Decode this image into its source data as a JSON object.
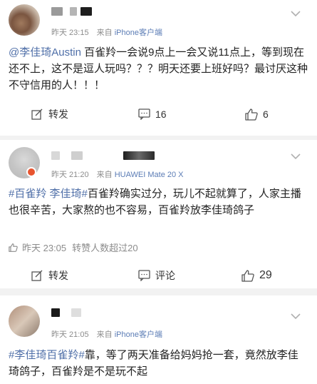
{
  "posts": [
    {
      "meta_date": "昨天 23:15",
      "meta_from": "来自",
      "meta_source": "iPhone客户端",
      "content": {
        "mention": "@李佳琦Austin",
        "text": " 百雀羚一会说9点上一会又说11点上，等到现在还不上，这不是逗人玩吗？？？明天还要上班好吗？最讨厌这种不守信用的人！！！"
      },
      "actions": {
        "repost": "转发",
        "comments": "16",
        "likes": "6"
      }
    },
    {
      "meta_date": "昨天 21:20",
      "meta_from": "来自",
      "meta_source": "HUAWEI Mate 20 X",
      "content": {
        "hashtag": "#百雀羚 李佳琦#",
        "text": "百雀羚确实过分，玩儿不起就算了，人家主播也很辛苦，大家熬的也不容易，百雀羚放李佳琦鸽子"
      },
      "sub_meta": {
        "date": "昨天 23:05",
        "text": "转赞人数超过20"
      },
      "actions": {
        "repost": "转发",
        "comments": "评论",
        "likes": "29"
      }
    },
    {
      "meta_date": "昨天 21:05",
      "meta_from": "来自",
      "meta_source": "iPhone客户端",
      "content": {
        "hashtag": "#李佳琦百雀羚#",
        "text": "靠，等了两天准备给妈妈抢一套，竟然放李佳琦鸽子，百雀羚是不是玩不起"
      }
    }
  ]
}
